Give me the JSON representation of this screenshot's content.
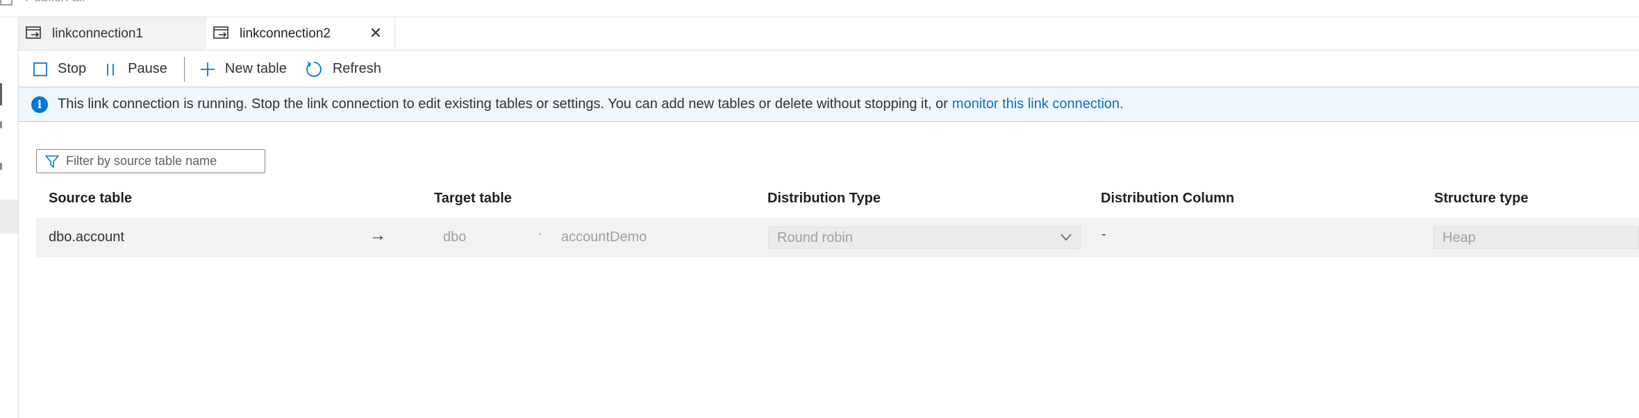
{
  "header": {
    "publish_all_label": "Publish all"
  },
  "tabs": [
    {
      "label": "linkconnection1",
      "icon": "link-connection-icon",
      "active": false
    },
    {
      "label": "linkconnection2",
      "icon": "link-connection-icon",
      "active": true
    }
  ],
  "toolbar": {
    "stop_label": "Stop",
    "pause_label": "Pause",
    "new_table_label": "New table",
    "refresh_label": "Refresh"
  },
  "banner": {
    "icon": "info-icon",
    "message": "This link connection is running. Stop the link connection to edit existing tables or settings. You can add new tables or delete without stopping it, or",
    "link_text": "monitor this link connection."
  },
  "filter": {
    "placeholder": "Filter by source table name",
    "value": ""
  },
  "table": {
    "columns": [
      "Source table",
      "Target table",
      "Distribution Type",
      "Distribution Column",
      "Structure type"
    ],
    "rows": [
      {
        "source": "dbo.account",
        "target_schema": "dbo",
        "separator": "·",
        "target_table": "accountDemo",
        "distribution_type": "Round robin",
        "distribution_column": "-",
        "structure_type": "Heap"
      }
    ]
  },
  "colors": {
    "accent": "#0078d4",
    "link": "#106ebe",
    "banner_bg": "#eff6fc",
    "row_bg": "#f3f2f1"
  }
}
